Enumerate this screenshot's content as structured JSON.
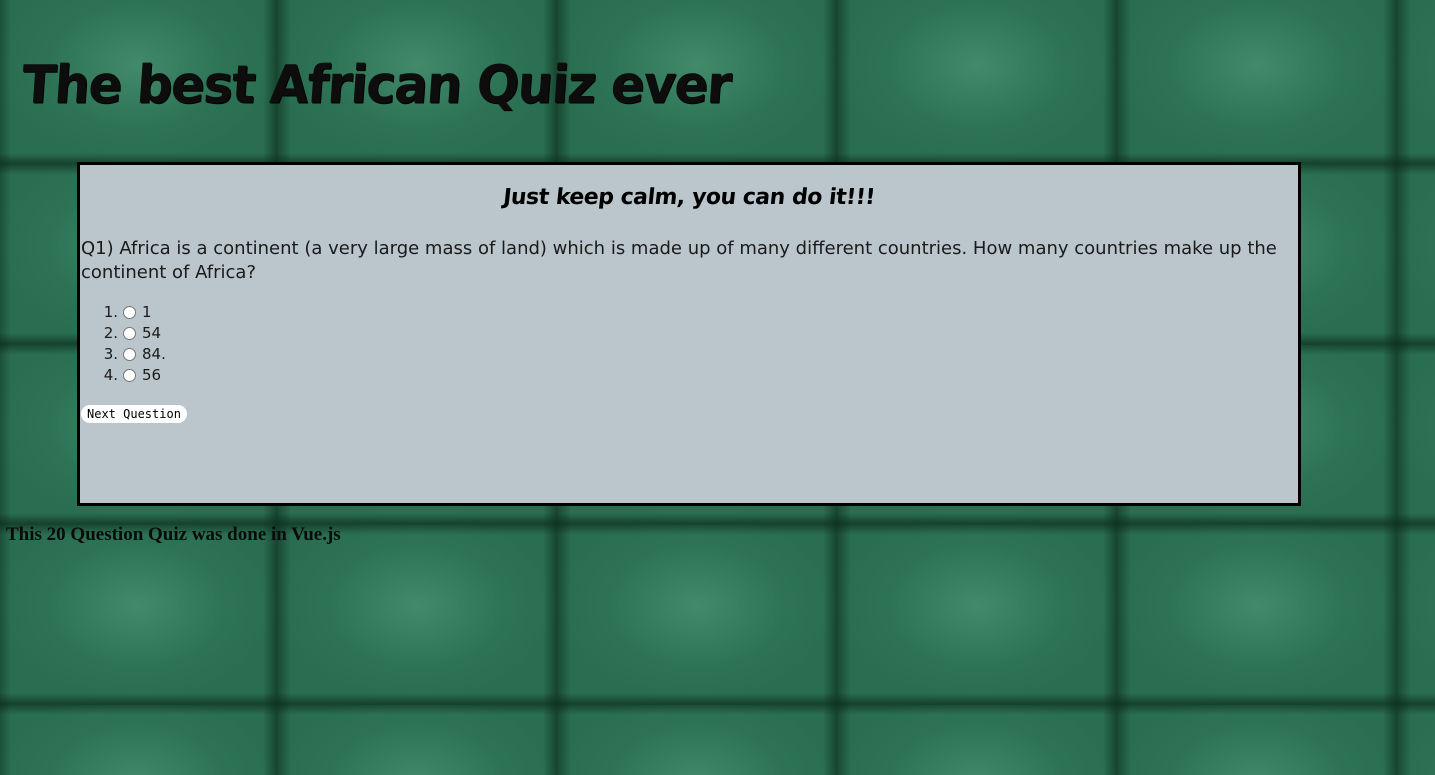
{
  "header": {
    "title": "The best African Quiz ever"
  },
  "quiz": {
    "encouragement": "Just keep calm, you can do it!!!",
    "question": "Q1) Africa is a continent (a very large mass of land) which is made up of many different countries. How many countries make up the continent of Africa?",
    "answers": [
      {
        "number": "1.",
        "label": "1",
        "selected": false
      },
      {
        "number": "2.",
        "label": "54",
        "selected": false
      },
      {
        "number": "3.",
        "label": "84.",
        "selected": false
      },
      {
        "number": "4.",
        "label": "56",
        "selected": false
      }
    ],
    "next_label": "Next Question"
  },
  "footer": {
    "note": "This 20 Question Quiz was done in Vue.js"
  }
}
